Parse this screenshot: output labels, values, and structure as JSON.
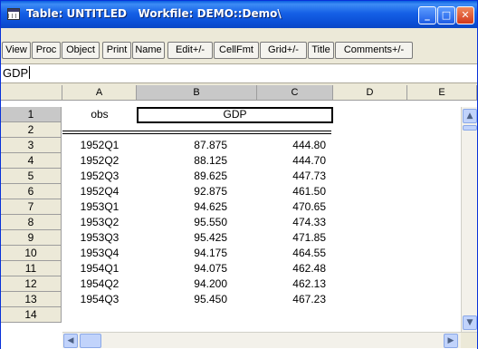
{
  "window": {
    "title": "Table: UNTITLED   Workfile: DEMO::Demo\\",
    "min_glyph": "_",
    "max_glyph": "□",
    "close_glyph": "✕"
  },
  "toolbar": {
    "buttons": [
      "View",
      "Proc",
      "Object",
      "Print",
      "Name",
      "Edit+/-",
      "CellFmt",
      "Grid+/-",
      "Title",
      "Comments+/-"
    ]
  },
  "edit_line": {
    "value": "GDP"
  },
  "grid": {
    "columns": [
      "A",
      "B",
      "C",
      "D",
      "E"
    ],
    "selected_columns": [
      "B",
      "C"
    ],
    "row1": {
      "row_label": "1",
      "obs": "obs",
      "gdp": "GDP"
    },
    "row2": {
      "row_label": "2"
    },
    "rows": [
      {
        "row_label": "3",
        "obs": "1952Q1",
        "b": "87.875",
        "c": "444.80"
      },
      {
        "row_label": "4",
        "obs": "1952Q2",
        "b": "88.125",
        "c": "444.70"
      },
      {
        "row_label": "5",
        "obs": "1952Q3",
        "b": "89.625",
        "c": "447.73"
      },
      {
        "row_label": "6",
        "obs": "1952Q4",
        "b": "92.875",
        "c": "461.50"
      },
      {
        "row_label": "7",
        "obs": "1953Q1",
        "b": "94.625",
        "c": "470.65"
      },
      {
        "row_label": "8",
        "obs": "1953Q2",
        "b": "95.550",
        "c": "474.33"
      },
      {
        "row_label": "9",
        "obs": "1953Q3",
        "b": "95.425",
        "c": "471.85"
      },
      {
        "row_label": "10",
        "obs": "1953Q4",
        "b": "94.175",
        "c": "464.55"
      },
      {
        "row_label": "11",
        "obs": "1954Q1",
        "b": "94.075",
        "c": "462.48"
      },
      {
        "row_label": "12",
        "obs": "1954Q2",
        "b": "94.200",
        "c": "462.13"
      },
      {
        "row_label": "13",
        "obs": "1954Q3",
        "b": "95.450",
        "c": "467.23"
      },
      {
        "row_label": "14"
      }
    ]
  },
  "scroll": {
    "up": "▲",
    "down": "▼",
    "left": "◀",
    "right": "▶"
  },
  "colors": {
    "titlebar": "#0a5fe0",
    "close": "#d2381b",
    "header_bg": "#ece9d8",
    "selected_header": "#c8c8c8"
  }
}
